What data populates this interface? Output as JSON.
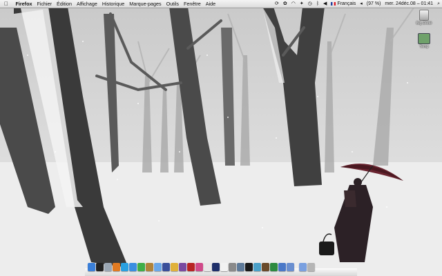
{
  "menubar": {
    "app_name": "Firefox",
    "menus": [
      "Fichier",
      "Édition",
      "Affichage",
      "Historique",
      "Marque-pages",
      "Outils",
      "Fenêtre",
      "Aide"
    ],
    "input_language": "Français",
    "battery": "(97 %)",
    "clock": "mer. 24déc.08 – 01:41",
    "status_icons": [
      "sync-icon",
      "paw-icon",
      "wifi-icon",
      "stars-icon",
      "time-machine-icon",
      "bluetooth-icon",
      "volume-icon",
      "flag-icon",
      "back-icon",
      "battery-icon",
      "spotlight-icon"
    ]
  },
  "desktop_icons": [
    {
      "label": "Big Dèdé",
      "icon": "hard-drive-icon"
    },
    {
      "label": "Temp",
      "icon": "folder-icon"
    }
  ],
  "dock": {
    "icons": [
      "finder-icon",
      "dashboard-icon",
      "mail-icon",
      "firefox-icon",
      "skype-icon",
      "safari-icon",
      "ichat-icon",
      "address-book-icon",
      "itunes-icon",
      "iphoto-icon",
      "garageband-icon",
      "imovie-icon",
      "photo-booth-icon",
      "preview-icon",
      "calendar-icon",
      "photoshop-icon",
      "textedit-icon",
      "system-preferences-icon",
      "utility-icon",
      "terminal-icon",
      "network-icon",
      "chess-icon",
      "activity-monitor-icon",
      "applications-folder-icon",
      "documents-folder-icon",
      "downloads-folder-icon",
      "trash-icon"
    ],
    "colors": [
      "#3a7fd8",
      "#222222",
      "#9aa6b3",
      "#e07a22",
      "#2aa0e0",
      "#3a8ee0",
      "#3fae48",
      "#b0833a",
      "#6aa7e8",
      "#3a4f9a",
      "#e0b13a",
      "#7a4aa0",
      "#b82424",
      "#d04a8a",
      "#e8e8e8",
      "#1e2f6a",
      "#f2f2f2",
      "#8a8a8a",
      "#5e7a99",
      "#1a1a1a",
      "#4aa0c8",
      "#6a4a2a",
      "#2d8a3f",
      "#4a78c8",
      "#6a8fd0",
      "#7aa0e0",
      "#b5b5b5"
    ]
  }
}
